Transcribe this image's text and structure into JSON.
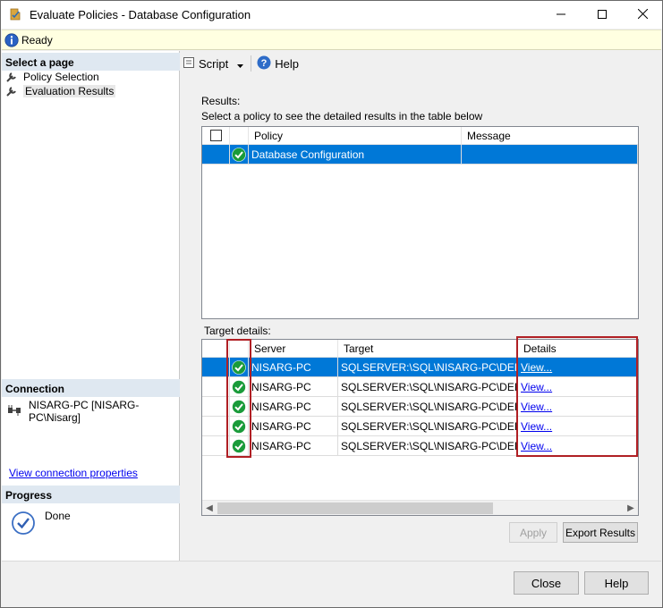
{
  "window": {
    "title": "Evaluate Policies - Database Configuration"
  },
  "status": {
    "text": "Ready"
  },
  "left": {
    "select_page_header": "Select a page",
    "pages": [
      {
        "label": "Policy Selection"
      },
      {
        "label": "Evaluation Results"
      }
    ],
    "connection_header": "Connection",
    "connection_name": "NISARG-PC [NISARG-PC\\Nisarg]",
    "connection_link": "View connection properties",
    "progress_header": "Progress",
    "progress_status": "Done"
  },
  "toolbar": {
    "script_label": "Script",
    "help_label": "Help"
  },
  "results": {
    "label": "Results:",
    "instruction": "Select a policy to see the detailed results in the table below",
    "columns": [
      "Policy",
      "Message"
    ],
    "rows": [
      {
        "policy": "Database Configuration",
        "message": ""
      }
    ]
  },
  "target_details": {
    "label": "Target details:",
    "columns": [
      "Server",
      "Target",
      "Details"
    ],
    "rows": [
      {
        "server": "NISARG-PC",
        "target": "SQLSERVER:\\SQL\\NISARG-PC\\DEF...",
        "details": "View..."
      },
      {
        "server": "NISARG-PC",
        "target": "SQLSERVER:\\SQL\\NISARG-PC\\DEF...",
        "details": "View..."
      },
      {
        "server": "NISARG-PC",
        "target": "SQLSERVER:\\SQL\\NISARG-PC\\DEF...",
        "details": "View..."
      },
      {
        "server": "NISARG-PC",
        "target": "SQLSERVER:\\SQL\\NISARG-PC\\DEF...",
        "details": "View..."
      },
      {
        "server": "NISARG-PC",
        "target": "SQLSERVER:\\SQL\\NISARG-PC\\DEF...",
        "details": "View..."
      }
    ]
  },
  "buttons": {
    "apply": "Apply",
    "export": "Export Results",
    "close": "Close",
    "help": "Help"
  },
  "colors": {
    "selection": "#0078d7",
    "highlight_box": "#b01f24",
    "success": "#1a9b3a"
  },
  "icons": [
    "policy-eval-icon",
    "minimize-icon",
    "maximize-icon",
    "close-icon",
    "info-icon",
    "wrench-icon",
    "connection-icon",
    "progress-check-icon",
    "script-icon",
    "help-icon",
    "success-check-icon"
  ]
}
